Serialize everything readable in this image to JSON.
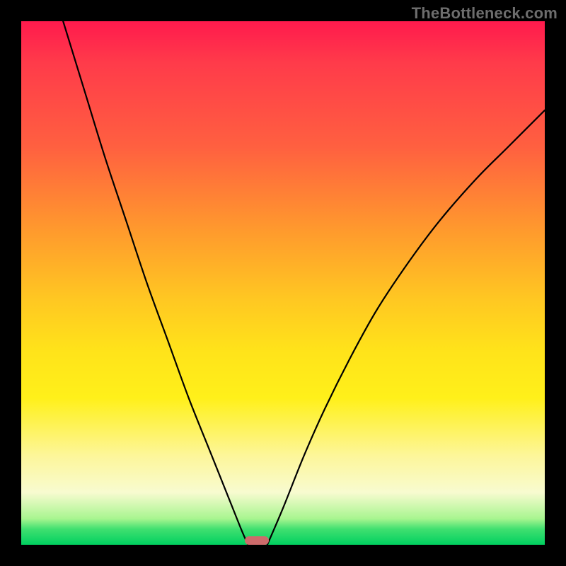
{
  "watermark": "TheBottleneck.com",
  "chart_data": {
    "type": "line",
    "title": "",
    "xlabel": "",
    "ylabel": "",
    "xlim": [
      0,
      1
    ],
    "ylim": [
      0,
      1
    ],
    "background_gradient": {
      "direction": "vertical",
      "colors": [
        "#ff1a4d",
        "#ff9a2d",
        "#ffe31a",
        "#f8fbd0",
        "#00d060"
      ],
      "meaning": "red=high bottleneck, green=no bottleneck"
    },
    "series": [
      {
        "name": "left-curve",
        "x": [
          0.08,
          0.12,
          0.16,
          0.2,
          0.24,
          0.28,
          0.32,
          0.36,
          0.4,
          0.42,
          0.433
        ],
        "y": [
          1.0,
          0.87,
          0.74,
          0.62,
          0.5,
          0.39,
          0.28,
          0.18,
          0.08,
          0.03,
          0.0
        ]
      },
      {
        "name": "right-curve",
        "x": [
          0.47,
          0.5,
          0.54,
          0.58,
          0.63,
          0.68,
          0.74,
          0.8,
          0.87,
          0.93,
          1.0
        ],
        "y": [
          0.0,
          0.07,
          0.17,
          0.26,
          0.36,
          0.45,
          0.54,
          0.62,
          0.7,
          0.76,
          0.83
        ]
      }
    ],
    "marker": {
      "x": 0.45,
      "y": 0.008,
      "shape": "rounded-rect",
      "color": "#cd6b6b"
    }
  }
}
